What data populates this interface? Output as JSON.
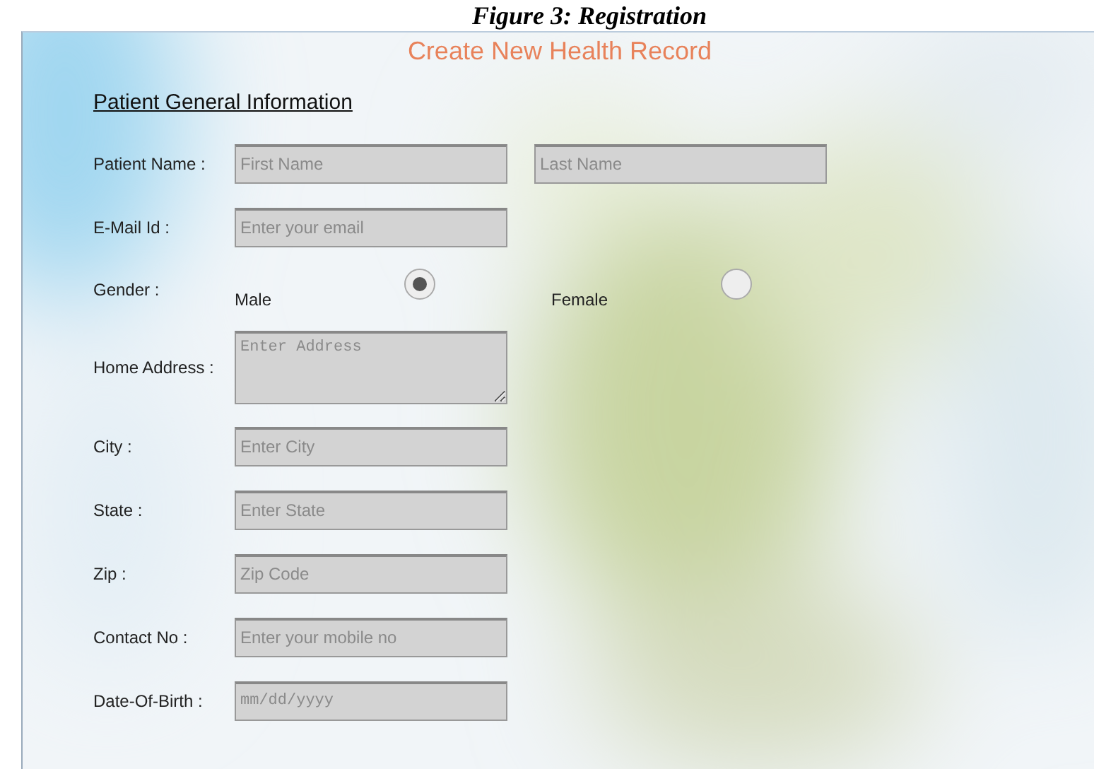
{
  "figure_caption": "Figure 3: Registration",
  "title": "Create New Health Record",
  "section_heading": "Patient General Information",
  "fields": [
    {
      "kind": "text_pair",
      "label": "Patient Name :",
      "inputs": [
        {
          "placeholder": "First Name"
        },
        {
          "placeholder": "Last Name"
        }
      ]
    },
    {
      "kind": "text",
      "label": "E-Mail Id :",
      "placeholder": "Enter your email"
    },
    {
      "kind": "radio",
      "label": "Gender :",
      "options": [
        {
          "label": "Male",
          "selected": true
        },
        {
          "label": "Female",
          "selected": false
        }
      ]
    },
    {
      "kind": "textarea",
      "label": "Home Address :",
      "placeholder": "Enter Address"
    },
    {
      "kind": "text",
      "label": "City :",
      "placeholder": "Enter City"
    },
    {
      "kind": "text",
      "label": "State :",
      "placeholder": "Enter State"
    },
    {
      "kind": "text",
      "label": "Zip :",
      "placeholder": "Zip Code"
    },
    {
      "kind": "text",
      "label": "Contact No :",
      "placeholder": "Enter your mobile no"
    },
    {
      "kind": "date",
      "label": "Date-Of-Birth :",
      "placeholder": "mm/dd/yyyy"
    }
  ]
}
